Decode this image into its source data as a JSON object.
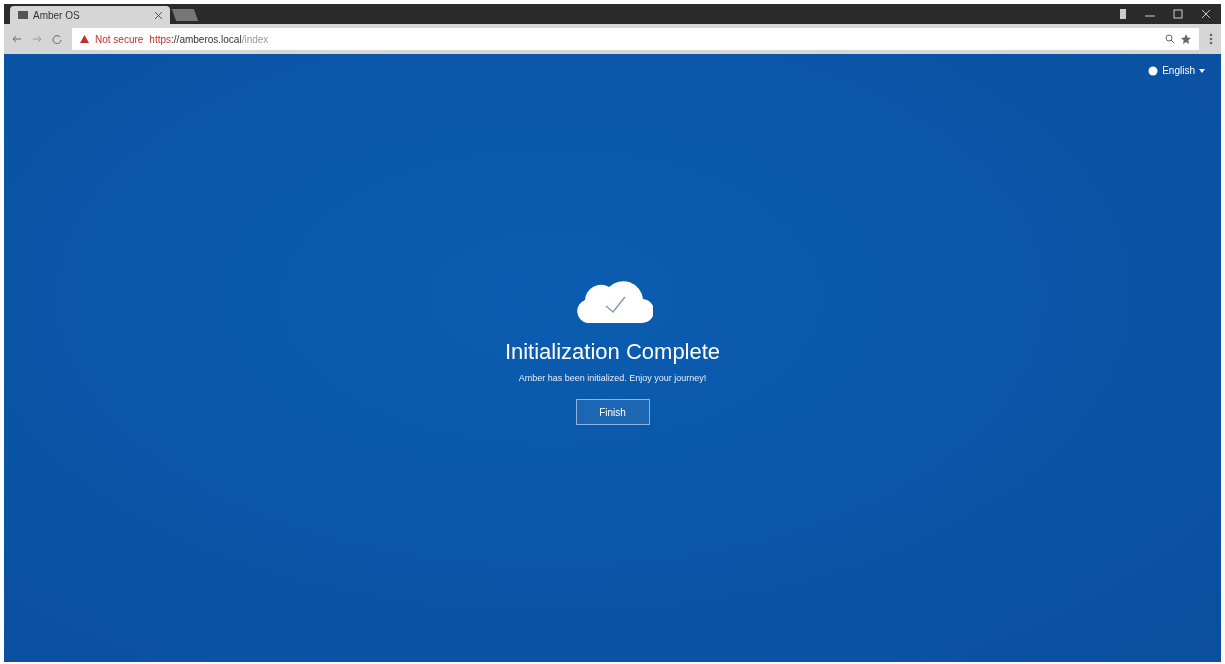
{
  "browser": {
    "tabs": [
      {
        "title": "Amber OS",
        "selected": true
      }
    ],
    "security": "Not secure",
    "url_scheme": "https",
    "url_host": "://amberos.local",
    "url_path": "/index"
  },
  "page": {
    "language": "English",
    "title": "Initialization Complete",
    "message": "Amber has been initialized. Enjoy your journey!",
    "button": "Finish"
  }
}
